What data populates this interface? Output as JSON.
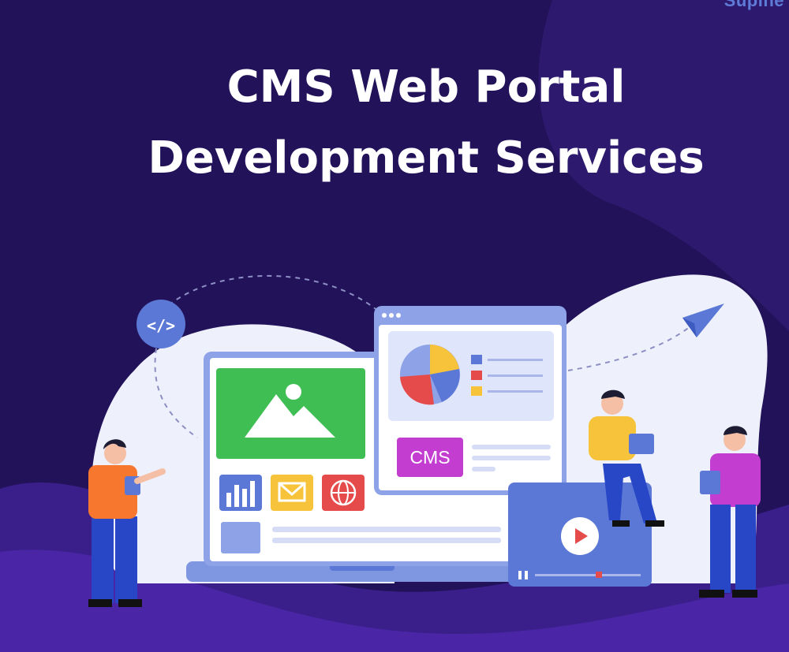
{
  "brand": "Supine",
  "heading": {
    "line1": "CMS Web Portal",
    "line2": "Development Services"
  },
  "cms_badge": "CMS",
  "code_badge": "</>",
  "colors": {
    "background": "#22125a",
    "accent_purple": "#c33ed0",
    "accent_green": "#3fbe54",
    "accent_blue": "#5b78d6",
    "accent_yellow": "#f6c33a",
    "accent_red": "#e64b4b"
  },
  "icons": [
    "image-icon",
    "bar-chart-icon",
    "mail-icon",
    "globe-icon",
    "pie-chart-icon",
    "play-icon",
    "paper-plane-icon",
    "code-icon",
    "pause-icon"
  ]
}
